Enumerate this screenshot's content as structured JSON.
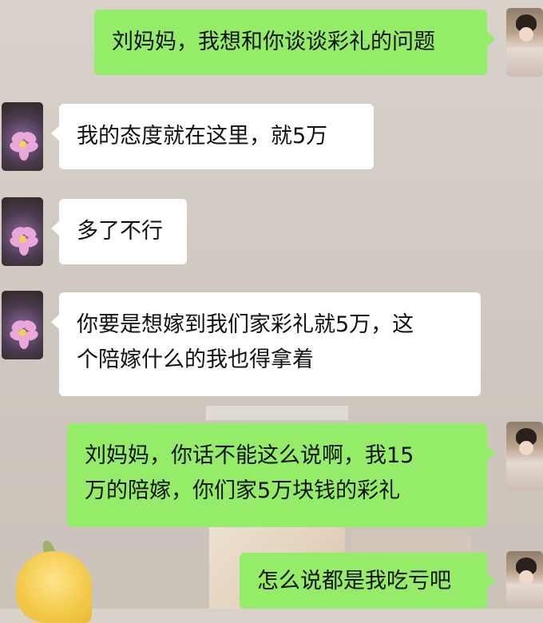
{
  "chat": {
    "messages": [
      {
        "sender": "me",
        "lines": [
          "刘妈妈，我想和你谈谈彩礼的问题"
        ]
      },
      {
        "sender": "other",
        "lines": [
          "我的态度就在这里，就5万"
        ]
      },
      {
        "sender": "other",
        "lines": [
          "多了不行"
        ]
      },
      {
        "sender": "other",
        "lines": [
          "你要是想嫁到我们家彩礼就5万，这",
          "个陪嫁什么的我也得拿着"
        ]
      },
      {
        "sender": "me",
        "lines": [
          "刘妈妈，你话不能这么说啊，我15",
          "万的陪嫁，你们家5万块钱的彩礼"
        ]
      },
      {
        "sender": "me",
        "lines": [
          "怎么说都是我吃亏吧"
        ]
      }
    ]
  },
  "colors": {
    "my_bubble": "#95ec69",
    "their_bubble": "#ffffff",
    "background": "#d4cdc6"
  },
  "icons": {
    "my_avatar": "user-photo-avatar",
    "their_avatar": "purple-flower-avatar"
  }
}
